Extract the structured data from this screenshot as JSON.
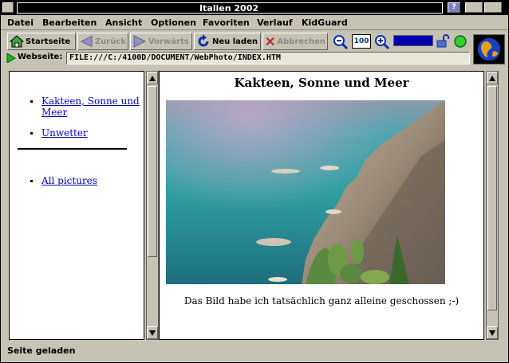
{
  "window": {
    "title": "Italien 2002"
  },
  "title_buttons": {
    "help": "?",
    "min": "▫",
    "max": "▢"
  },
  "menu": [
    "Datei",
    "Bearbeiten",
    "Ansicht",
    "Optionen",
    "Favoriten",
    "Verlauf",
    "KidGuard"
  ],
  "toolbar": {
    "home_label": "Startseite",
    "back_label": "Zurück",
    "forward_label": "Vorwärts",
    "reload_label": "Neu laden",
    "stop_label": "Abbrechen",
    "zoom_value": "100"
  },
  "address": {
    "label": "Webseite:",
    "url": "FILE:///C:/4100D/DOCUMENT/WebPhoto/INDEX.HTM"
  },
  "left_frame": {
    "links": [
      "Kakteen, Sonne und Meer",
      "Unwetter"
    ],
    "links_after_rule": [
      "All pictures"
    ]
  },
  "main": {
    "title": "Kakteen, Sonne und Meer",
    "caption": "Das Bild habe ich tatsächlich ganz alleine geschossen ;-)"
  },
  "status": {
    "text": "Seite geladen"
  },
  "colors": {
    "link": "#0000cc",
    "chrome": "#c6c3b5",
    "progress": "#0000b0"
  }
}
